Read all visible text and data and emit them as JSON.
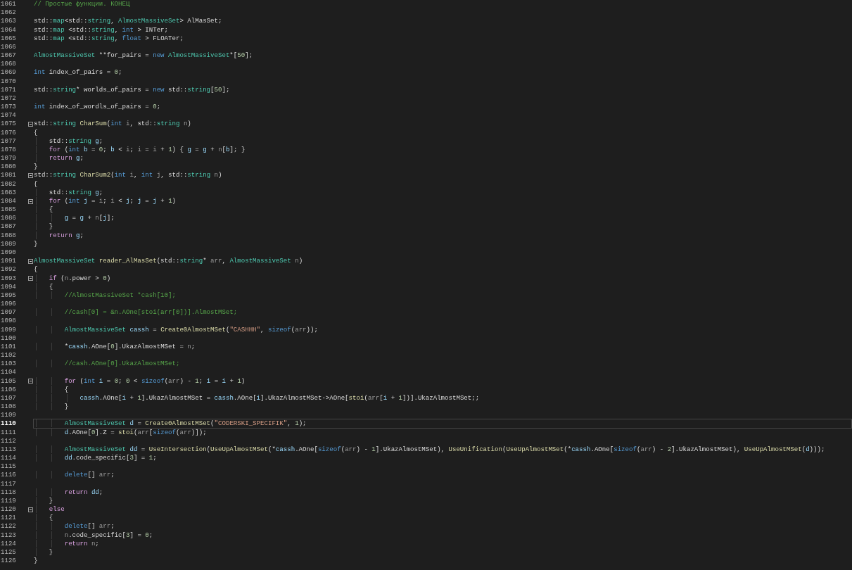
{
  "editor": {
    "lines": [
      {
        "number": "1061",
        "fold": false,
        "current": false,
        "tokens": [
          {
            "kind": "comment",
            "text": "// Простые функции. КОНЕЦ"
          }
        ]
      },
      {
        "number": "1062",
        "fold": false,
        "current": false
      },
      {
        "number": "1063",
        "fold": false,
        "current": false,
        "tokens": [
          {
            "kind": "plain",
            "text": "std::"
          },
          {
            "kind": "type",
            "text": "map"
          },
          {
            "kind": "plain",
            "text": "<std::"
          },
          {
            "kind": "type",
            "text": "string"
          },
          {
            "kind": "plain",
            "text": ", "
          },
          {
            "kind": "type",
            "text": "AlmostMassiveSet"
          },
          {
            "kind": "plain",
            "text": "> AlMasSet;"
          }
        ]
      },
      {
        "number": "1064",
        "fold": false,
        "current": false,
        "tokens": [
          {
            "kind": "plain",
            "text": "std::"
          },
          {
            "kind": "type",
            "text": "map"
          },
          {
            "kind": "plain",
            "text": " <std::"
          },
          {
            "kind": "type",
            "text": "string"
          },
          {
            "kind": "plain",
            "text": ", "
          },
          {
            "kind": "keyword",
            "text": "int"
          },
          {
            "kind": "plain",
            "text": " > INTer;"
          }
        ]
      },
      {
        "number": "1065",
        "fold": false,
        "current": false,
        "tokens": [
          {
            "kind": "plain",
            "text": "std::"
          },
          {
            "kind": "type",
            "text": "map"
          },
          {
            "kind": "plain",
            "text": " <std::"
          },
          {
            "kind": "type",
            "text": "string"
          },
          {
            "kind": "plain",
            "text": ", "
          },
          {
            "kind": "keyword",
            "text": "float"
          },
          {
            "kind": "plain",
            "text": " > FLOATer;"
          }
        ]
      },
      {
        "number": "1066",
        "fold": false,
        "current": false
      },
      {
        "number": "1067",
        "fold": false,
        "current": false,
        "tokens": [
          {
            "kind": "type",
            "text": "AlmostMassiveSet"
          },
          {
            "kind": "plain",
            "text": " **for_pairs = "
          },
          {
            "kind": "keyword",
            "text": "new"
          },
          {
            "kind": "type",
            "text": " AlmostMassiveSet"
          },
          {
            "kind": "plain",
            "text": "*["
          },
          {
            "kind": "number",
            "text": "50"
          },
          {
            "kind": "plain",
            "text": "];"
          }
        ]
      },
      {
        "number": "1068",
        "fold": false,
        "current": false
      },
      {
        "number": "1069",
        "fold": false,
        "current": false,
        "tokens": [
          {
            "kind": "keyword",
            "text": "int"
          },
          {
            "kind": "plain",
            "text": " index_of_pairs = "
          },
          {
            "kind": "number",
            "text": "0"
          },
          {
            "kind": "plain",
            "text": ";"
          }
        ]
      },
      {
        "number": "1070",
        "fold": false,
        "current": false
      },
      {
        "number": "1071",
        "fold": false,
        "current": false,
        "tokens": [
          {
            "kind": "plain",
            "text": "std::"
          },
          {
            "kind": "type",
            "text": "string"
          },
          {
            "kind": "plain",
            "text": "* worlds_of_pairs = "
          },
          {
            "kind": "keyword",
            "text": "new"
          },
          {
            "kind": "plain",
            "text": " std::"
          },
          {
            "kind": "type",
            "text": "string"
          },
          {
            "kind": "plain",
            "text": "["
          },
          {
            "kind": "number",
            "text": "50"
          },
          {
            "kind": "plain",
            "text": "];"
          }
        ]
      },
      {
        "number": "1072",
        "fold": false,
        "current": false
      },
      {
        "number": "1073",
        "fold": false,
        "current": false,
        "tokens": [
          {
            "kind": "keyword",
            "text": "int"
          },
          {
            "kind": "plain",
            "text": " index_of_wordls_of_pairs = "
          },
          {
            "kind": "number",
            "text": "0"
          },
          {
            "kind": "plain",
            "text": ";"
          }
        ]
      },
      {
        "number": "1074",
        "fold": false,
        "current": false
      },
      {
        "number": "1075",
        "fold": true,
        "current": false,
        "tokens": [
          {
            "kind": "plain",
            "text": "std::"
          },
          {
            "kind": "type",
            "text": "string"
          },
          {
            "kind": "function",
            "text": " CharSum"
          },
          {
            "kind": "plain",
            "text": "("
          },
          {
            "kind": "keyword",
            "text": "int"
          },
          {
            "kind": "param",
            "text": " i"
          },
          {
            "kind": "plain",
            "text": ", std::"
          },
          {
            "kind": "type",
            "text": "string"
          },
          {
            "kind": "param",
            "text": " n"
          },
          {
            "kind": "plain",
            "text": ")"
          }
        ]
      },
      {
        "number": "1076",
        "fold": false,
        "current": false,
        "tokens": [
          {
            "kind": "plain",
            "text": "{"
          }
        ]
      },
      {
        "number": "1077",
        "fold": false,
        "current": false,
        "tokens": [
          {
            "kind": "plain",
            "text": "    std::"
          },
          {
            "kind": "type",
            "text": "string"
          },
          {
            "kind": "local",
            "text": " g"
          },
          {
            "kind": "plain",
            "text": ";"
          }
        ]
      },
      {
        "number": "1078",
        "fold": false,
        "current": false,
        "tokens": [
          {
            "kind": "control",
            "text": "    for"
          },
          {
            "kind": "plain",
            "text": " ("
          },
          {
            "kind": "keyword",
            "text": "int"
          },
          {
            "kind": "local",
            "text": " b"
          },
          {
            "kind": "plain",
            "text": " = "
          },
          {
            "kind": "number",
            "text": "0"
          },
          {
            "kind": "plain",
            "text": "; "
          },
          {
            "kind": "local",
            "text": "b"
          },
          {
            "kind": "plain",
            "text": " < "
          },
          {
            "kind": "param",
            "text": "i"
          },
          {
            "kind": "plain",
            "text": "; "
          },
          {
            "kind": "param",
            "text": "i"
          },
          {
            "kind": "plain",
            "text": " = "
          },
          {
            "kind": "param",
            "text": "i"
          },
          {
            "kind": "plain",
            "text": " + "
          },
          {
            "kind": "number",
            "text": "1"
          },
          {
            "kind": "plain",
            "text": ") { "
          },
          {
            "kind": "local",
            "text": "g"
          },
          {
            "kind": "plain",
            "text": " = "
          },
          {
            "kind": "local",
            "text": "g"
          },
          {
            "kind": "plain",
            "text": " + "
          },
          {
            "kind": "param",
            "text": "n"
          },
          {
            "kind": "plain",
            "text": "["
          },
          {
            "kind": "local",
            "text": "b"
          },
          {
            "kind": "plain",
            "text": "]; }"
          }
        ]
      },
      {
        "number": "1079",
        "fold": false,
        "current": false,
        "tokens": [
          {
            "kind": "control",
            "text": "    return"
          },
          {
            "kind": "local",
            "text": " g"
          },
          {
            "kind": "plain",
            "text": ";"
          }
        ]
      },
      {
        "number": "1080",
        "fold": false,
        "current": false,
        "tokens": [
          {
            "kind": "plain",
            "text": "}"
          }
        ]
      },
      {
        "number": "1081",
        "fold": true,
        "current": false,
        "tokens": [
          {
            "kind": "plain",
            "text": "std::"
          },
          {
            "kind": "type",
            "text": "string"
          },
          {
            "kind": "function",
            "text": " CharSum2"
          },
          {
            "kind": "plain",
            "text": "("
          },
          {
            "kind": "keyword",
            "text": "int"
          },
          {
            "kind": "param",
            "text": " i"
          },
          {
            "kind": "plain",
            "text": ", "
          },
          {
            "kind": "keyword",
            "text": "int"
          },
          {
            "kind": "param",
            "text": " j"
          },
          {
            "kind": "plain",
            "text": ", std::"
          },
          {
            "kind": "type",
            "text": "string"
          },
          {
            "kind": "param",
            "text": " n"
          },
          {
            "kind": "plain",
            "text": ")"
          }
        ]
      },
      {
        "number": "1082",
        "fold": false,
        "current": false,
        "tokens": [
          {
            "kind": "plain",
            "text": "{"
          }
        ]
      },
      {
        "number": "1083",
        "fold": false,
        "current": false,
        "tokens": [
          {
            "kind": "plain",
            "text": "    std::"
          },
          {
            "kind": "type",
            "text": "string"
          },
          {
            "kind": "local",
            "text": " g"
          },
          {
            "kind": "plain",
            "text": ";"
          }
        ]
      },
      {
        "number": "1084",
        "fold": true,
        "current": false,
        "tokens": [
          {
            "kind": "control",
            "text": "    for"
          },
          {
            "kind": "plain",
            "text": " ("
          },
          {
            "kind": "keyword",
            "text": "int"
          },
          {
            "kind": "local",
            "text": " j"
          },
          {
            "kind": "plain",
            "text": " = "
          },
          {
            "kind": "param",
            "text": "i"
          },
          {
            "kind": "plain",
            "text": "; "
          },
          {
            "kind": "param",
            "text": "i"
          },
          {
            "kind": "plain",
            "text": " < "
          },
          {
            "kind": "local",
            "text": "j"
          },
          {
            "kind": "plain",
            "text": "; "
          },
          {
            "kind": "local",
            "text": "j"
          },
          {
            "kind": "plain",
            "text": " = "
          },
          {
            "kind": "local",
            "text": "j"
          },
          {
            "kind": "plain",
            "text": " + "
          },
          {
            "kind": "number",
            "text": "1"
          },
          {
            "kind": "plain",
            "text": ")"
          }
        ]
      },
      {
        "number": "1085",
        "fold": false,
        "current": false,
        "tokens": [
          {
            "kind": "plain",
            "text": "    {"
          }
        ]
      },
      {
        "number": "1086",
        "fold": false,
        "current": false,
        "tokens": [
          {
            "kind": "local",
            "text": "        g"
          },
          {
            "kind": "plain",
            "text": " = "
          },
          {
            "kind": "local",
            "text": "g"
          },
          {
            "kind": "plain",
            "text": " + "
          },
          {
            "kind": "param",
            "text": "n"
          },
          {
            "kind": "plain",
            "text": "["
          },
          {
            "kind": "local",
            "text": "j"
          },
          {
            "kind": "plain",
            "text": "];"
          }
        ]
      },
      {
        "number": "1087",
        "fold": false,
        "current": false,
        "tokens": [
          {
            "kind": "plain",
            "text": "    }"
          }
        ]
      },
      {
        "number": "1088",
        "fold": false,
        "current": false,
        "tokens": [
          {
            "kind": "control",
            "text": "    return"
          },
          {
            "kind": "local",
            "text": " g"
          },
          {
            "kind": "plain",
            "text": ";"
          }
        ]
      },
      {
        "number": "1089",
        "fold": false,
        "current": false,
        "tokens": [
          {
            "kind": "plain",
            "text": "}"
          }
        ]
      },
      {
        "number": "1090",
        "fold": false,
        "current": false
      },
      {
        "number": "1091",
        "fold": true,
        "current": false,
        "tokens": [
          {
            "kind": "type",
            "text": "AlmostMassiveSet"
          },
          {
            "kind": "function",
            "text": " reader_AlMasSet"
          },
          {
            "kind": "plain",
            "text": "(std::"
          },
          {
            "kind": "type",
            "text": "string"
          },
          {
            "kind": "plain",
            "text": "* "
          },
          {
            "kind": "param",
            "text": "arr"
          },
          {
            "kind": "plain",
            "text": ", "
          },
          {
            "kind": "type",
            "text": "AlmostMassiveSet"
          },
          {
            "kind": "param",
            "text": " n"
          },
          {
            "kind": "plain",
            "text": ")"
          }
        ]
      },
      {
        "number": "1092",
        "fold": false,
        "current": false,
        "tokens": [
          {
            "kind": "plain",
            "text": "{"
          }
        ]
      },
      {
        "number": "1093",
        "fold": true,
        "current": false,
        "tokens": [
          {
            "kind": "control",
            "text": "    if"
          },
          {
            "kind": "plain",
            "text": " ("
          },
          {
            "kind": "param",
            "text": "n"
          },
          {
            "kind": "plain",
            "text": ".power > "
          },
          {
            "kind": "number",
            "text": "0"
          },
          {
            "kind": "plain",
            "text": ")"
          }
        ]
      },
      {
        "number": "1094",
        "fold": false,
        "current": false,
        "tokens": [
          {
            "kind": "plain",
            "text": "    {"
          }
        ]
      },
      {
        "number": "1095",
        "fold": false,
        "current": false,
        "tokens": [
          {
            "kind": "comment",
            "text": "        //AlmostMassiveSet *cash[10];"
          }
        ]
      },
      {
        "number": "1096",
        "fold": false,
        "current": false
      },
      {
        "number": "1097",
        "fold": false,
        "current": false,
        "tokens": [
          {
            "kind": "comment",
            "text": "        //cash[0] = &n.AOne[stoi(arr[0])].AlmostMSet;"
          }
        ]
      },
      {
        "number": "1098",
        "fold": false,
        "current": false
      },
      {
        "number": "1099",
        "fold": false,
        "current": false,
        "tokens": [
          {
            "kind": "type",
            "text": "        AlmostMassiveSet"
          },
          {
            "kind": "local",
            "text": " cassh"
          },
          {
            "kind": "plain",
            "text": " = "
          },
          {
            "kind": "function",
            "text": "Create0AlmostMSet"
          },
          {
            "kind": "plain",
            "text": "("
          },
          {
            "kind": "string",
            "text": "\"CASHHH\""
          },
          {
            "kind": "plain",
            "text": ", "
          },
          {
            "kind": "keyword",
            "text": "sizeof"
          },
          {
            "kind": "plain",
            "text": "("
          },
          {
            "kind": "param",
            "text": "arr"
          },
          {
            "kind": "plain",
            "text": "));"
          }
        ]
      },
      {
        "number": "1100",
        "fold": false,
        "current": false
      },
      {
        "number": "1101",
        "fold": false,
        "current": false,
        "tokens": [
          {
            "kind": "plain",
            "text": "        *"
          },
          {
            "kind": "local",
            "text": "cassh"
          },
          {
            "kind": "plain",
            "text": ".AOne["
          },
          {
            "kind": "number",
            "text": "0"
          },
          {
            "kind": "plain",
            "text": "].UkazAlmostMSet = "
          },
          {
            "kind": "param",
            "text": "n"
          },
          {
            "kind": "plain",
            "text": ";"
          }
        ]
      },
      {
        "number": "1102",
        "fold": false,
        "current": false
      },
      {
        "number": "1103",
        "fold": false,
        "current": false,
        "tokens": [
          {
            "kind": "comment",
            "text": "        //cash.AOne[0].UkazAlmostMSet;"
          }
        ]
      },
      {
        "number": "1104",
        "fold": false,
        "current": false
      },
      {
        "number": "1105",
        "fold": true,
        "current": false,
        "tokens": [
          {
            "kind": "control",
            "text": "        for"
          },
          {
            "kind": "plain",
            "text": " ("
          },
          {
            "kind": "keyword",
            "text": "int"
          },
          {
            "kind": "local",
            "text": " i"
          },
          {
            "kind": "plain",
            "text": " = "
          },
          {
            "kind": "number",
            "text": "0"
          },
          {
            "kind": "plain",
            "text": "; "
          },
          {
            "kind": "number",
            "text": "0"
          },
          {
            "kind": "plain",
            "text": " < "
          },
          {
            "kind": "keyword",
            "text": "sizeof"
          },
          {
            "kind": "plain",
            "text": "("
          },
          {
            "kind": "param",
            "text": "arr"
          },
          {
            "kind": "plain",
            "text": ") - "
          },
          {
            "kind": "number",
            "text": "1"
          },
          {
            "kind": "plain",
            "text": "; "
          },
          {
            "kind": "local",
            "text": "i"
          },
          {
            "kind": "plain",
            "text": " = "
          },
          {
            "kind": "local",
            "text": "i"
          },
          {
            "kind": "plain",
            "text": " + "
          },
          {
            "kind": "number",
            "text": "1"
          },
          {
            "kind": "plain",
            "text": ")"
          }
        ]
      },
      {
        "number": "1106",
        "fold": false,
        "current": false,
        "tokens": [
          {
            "kind": "plain",
            "text": "        {"
          }
        ]
      },
      {
        "number": "1107",
        "fold": false,
        "current": false,
        "tokens": [
          {
            "kind": "local",
            "text": "            cassh"
          },
          {
            "kind": "plain",
            "text": ".AOne["
          },
          {
            "kind": "local",
            "text": "i"
          },
          {
            "kind": "plain",
            "text": " + "
          },
          {
            "kind": "number",
            "text": "1"
          },
          {
            "kind": "plain",
            "text": "].UkazAlmostMSet = "
          },
          {
            "kind": "local",
            "text": "cassh"
          },
          {
            "kind": "plain",
            "text": ".AOne["
          },
          {
            "kind": "local",
            "text": "i"
          },
          {
            "kind": "plain",
            "text": "].UkazAlmostMSet->AOne["
          },
          {
            "kind": "function",
            "text": "stoi"
          },
          {
            "kind": "plain",
            "text": "("
          },
          {
            "kind": "param",
            "text": "arr"
          },
          {
            "kind": "plain",
            "text": "["
          },
          {
            "kind": "local",
            "text": "i"
          },
          {
            "kind": "plain",
            "text": " + "
          },
          {
            "kind": "number",
            "text": "1"
          },
          {
            "kind": "plain",
            "text": "])].UkazAlmostMSet;;"
          }
        ]
      },
      {
        "number": "1108",
        "fold": false,
        "current": false,
        "tokens": [
          {
            "kind": "plain",
            "text": "        }"
          }
        ]
      },
      {
        "number": "1109",
        "fold": false,
        "current": false
      },
      {
        "number": "1110",
        "fold": false,
        "current": true,
        "tokens": [
          {
            "kind": "type",
            "text": "        AlmostMassiveSet"
          },
          {
            "kind": "local",
            "text": " d"
          },
          {
            "kind": "plain",
            "text": " = "
          },
          {
            "kind": "function",
            "text": "Create0AlmostMSet"
          },
          {
            "kind": "plain",
            "text": "("
          },
          {
            "kind": "string",
            "text": "\"CODERSKI_SPECIFIK\""
          },
          {
            "kind": "plain",
            "text": ", "
          },
          {
            "kind": "number",
            "text": "1"
          },
          {
            "kind": "plain",
            "text": ");"
          }
        ]
      },
      {
        "number": "1111",
        "fold": false,
        "current": false,
        "tokens": [
          {
            "kind": "local",
            "text": "        d"
          },
          {
            "kind": "plain",
            "text": ".AOne["
          },
          {
            "kind": "number",
            "text": "0"
          },
          {
            "kind": "plain",
            "text": "].Z = "
          },
          {
            "kind": "function",
            "text": "stoi"
          },
          {
            "kind": "plain",
            "text": "("
          },
          {
            "kind": "param",
            "text": "arr"
          },
          {
            "kind": "plain",
            "text": "["
          },
          {
            "kind": "keyword",
            "text": "sizeof"
          },
          {
            "kind": "plain",
            "text": "("
          },
          {
            "kind": "param",
            "text": "arr"
          },
          {
            "kind": "plain",
            "text": ")]);"
          }
        ]
      },
      {
        "number": "1112",
        "fold": false,
        "current": false
      },
      {
        "number": "1113",
        "fold": false,
        "current": false,
        "tokens": [
          {
            "kind": "type",
            "text": "        AlmostMassiveSet"
          },
          {
            "kind": "local",
            "text": " dd"
          },
          {
            "kind": "plain",
            "text": " = "
          },
          {
            "kind": "function",
            "text": "UseIntersection"
          },
          {
            "kind": "plain",
            "text": "("
          },
          {
            "kind": "function",
            "text": "UseUpAlmostMSet"
          },
          {
            "kind": "plain",
            "text": "(*"
          },
          {
            "kind": "local",
            "text": "cassh"
          },
          {
            "kind": "plain",
            "text": ".AOne["
          },
          {
            "kind": "keyword",
            "text": "sizeof"
          },
          {
            "kind": "plain",
            "text": "("
          },
          {
            "kind": "param",
            "text": "arr"
          },
          {
            "kind": "plain",
            "text": ") - "
          },
          {
            "kind": "number",
            "text": "1"
          },
          {
            "kind": "plain",
            "text": "].UkazAlmostMSet), "
          },
          {
            "kind": "function",
            "text": "UseUnification"
          },
          {
            "kind": "plain",
            "text": "("
          },
          {
            "kind": "function",
            "text": "UseUpAlmostMSet"
          },
          {
            "kind": "plain",
            "text": "(*"
          },
          {
            "kind": "local",
            "text": "cassh"
          },
          {
            "kind": "plain",
            "text": ".AOne["
          },
          {
            "kind": "keyword",
            "text": "sizeof"
          },
          {
            "kind": "plain",
            "text": "("
          },
          {
            "kind": "param",
            "text": "arr"
          },
          {
            "kind": "plain",
            "text": ") - "
          },
          {
            "kind": "number",
            "text": "2"
          },
          {
            "kind": "plain",
            "text": "].UkazAlmostMSet), "
          },
          {
            "kind": "function",
            "text": "UseUpAlmostMSet"
          },
          {
            "kind": "plain",
            "text": "("
          },
          {
            "kind": "local",
            "text": "d"
          },
          {
            "kind": "plain",
            "text": ")));"
          }
        ]
      },
      {
        "number": "1114",
        "fold": false,
        "current": false,
        "tokens": [
          {
            "kind": "local",
            "text": "        dd"
          },
          {
            "kind": "plain",
            "text": ".code_specific["
          },
          {
            "kind": "number",
            "text": "3"
          },
          {
            "kind": "plain",
            "text": "] = "
          },
          {
            "kind": "number",
            "text": "1"
          },
          {
            "kind": "plain",
            "text": ";"
          }
        ]
      },
      {
        "number": "1115",
        "fold": false,
        "current": false
      },
      {
        "number": "1116",
        "fold": false,
        "current": false,
        "tokens": [
          {
            "kind": "keyword",
            "text": "        delete"
          },
          {
            "kind": "plain",
            "text": "[] "
          },
          {
            "kind": "param",
            "text": "arr"
          },
          {
            "kind": "plain",
            "text": ";"
          }
        ]
      },
      {
        "number": "1117",
        "fold": false,
        "current": false
      },
      {
        "number": "1118",
        "fold": false,
        "current": false,
        "tokens": [
          {
            "kind": "control",
            "text": "        return"
          },
          {
            "kind": "local",
            "text": " dd"
          },
          {
            "kind": "plain",
            "text": ";"
          }
        ]
      },
      {
        "number": "1119",
        "fold": false,
        "current": false,
        "tokens": [
          {
            "kind": "plain",
            "text": "    }"
          }
        ]
      },
      {
        "number": "1120",
        "fold": true,
        "current": false,
        "tokens": [
          {
            "kind": "control",
            "text": "    else"
          }
        ]
      },
      {
        "number": "1121",
        "fold": false,
        "current": false,
        "tokens": [
          {
            "kind": "plain",
            "text": "    {"
          }
        ]
      },
      {
        "number": "1122",
        "fold": false,
        "current": false,
        "tokens": [
          {
            "kind": "keyword",
            "text": "        delete"
          },
          {
            "kind": "plain",
            "text": "[] "
          },
          {
            "kind": "param",
            "text": "arr"
          },
          {
            "kind": "plain",
            "text": ";"
          }
        ]
      },
      {
        "number": "1123",
        "fold": false,
        "current": false,
        "tokens": [
          {
            "kind": "param",
            "text": "        n"
          },
          {
            "kind": "plain",
            "text": ".code_specific["
          },
          {
            "kind": "number",
            "text": "3"
          },
          {
            "kind": "plain",
            "text": "] = "
          },
          {
            "kind": "number",
            "text": "0"
          },
          {
            "kind": "plain",
            "text": ";"
          }
        ]
      },
      {
        "number": "1124",
        "fold": false,
        "current": false,
        "tokens": [
          {
            "kind": "control",
            "text": "        return"
          },
          {
            "kind": "param",
            "text": " n"
          },
          {
            "kind": "plain",
            "text": ";"
          }
        ]
      },
      {
        "number": "1125",
        "fold": false,
        "current": false,
        "tokens": [
          {
            "kind": "plain",
            "text": "    }"
          }
        ]
      },
      {
        "number": "1126",
        "fold": false,
        "current": false,
        "tokens": [
          {
            "kind": "plain",
            "text": "}"
          }
        ]
      }
    ]
  }
}
